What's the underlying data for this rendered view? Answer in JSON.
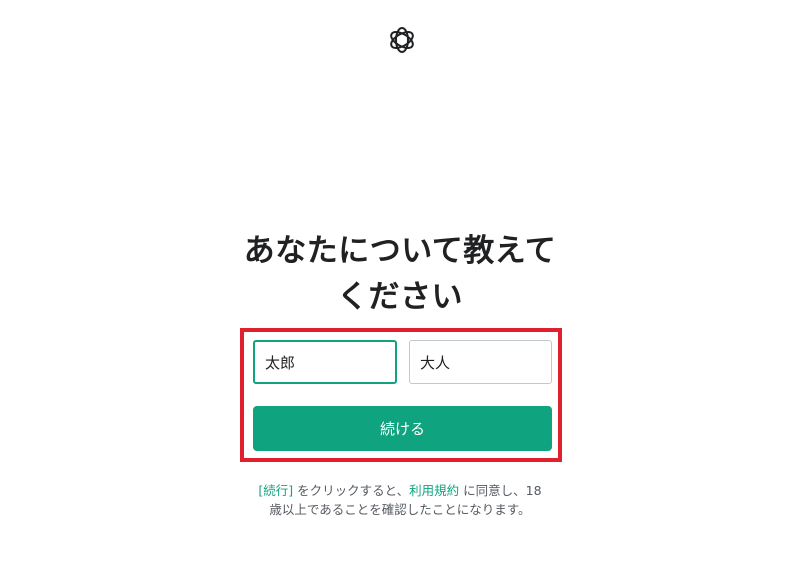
{
  "logo": {
    "icon": "openai-logo-icon"
  },
  "page": {
    "title_line1": "あなたについて教えて",
    "title_line2": "ください"
  },
  "form": {
    "first_name_value": "太郎",
    "last_name_value": "大人",
    "continue_label": "続ける"
  },
  "terms": {
    "link_continue": "[続行]",
    "text_part1": " をクリックすると、",
    "link_terms": "利用規約",
    "text_part2": " に同意し、18",
    "line2": "歳以上であることを確認したことになります。"
  },
  "colors": {
    "accent": "#10a37f",
    "highlight_border": "#e0202c",
    "title": "#202123"
  }
}
